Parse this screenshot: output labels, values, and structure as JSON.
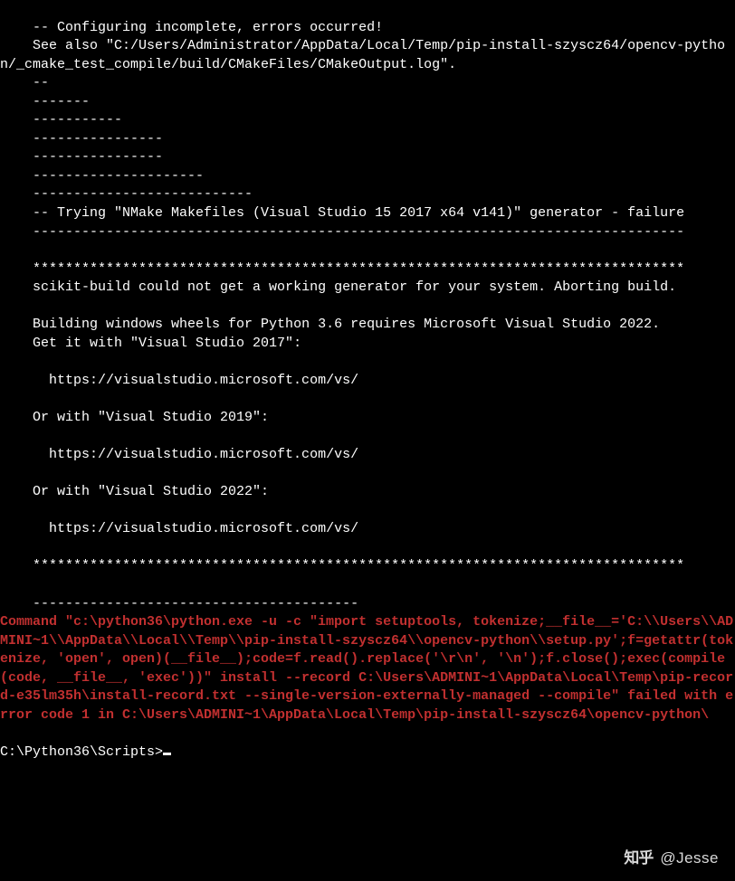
{
  "terminal": {
    "lines_white": [
      "    -- Configuring incomplete, errors occurred!",
      "    See also \"C:/Users/Administrator/AppData/Local/Temp/pip-install-szyscz64/opencv-python/_cmake_test_compile/build/CMakeFiles/CMakeOutput.log\".",
      "    --",
      "    -------",
      "    -----------",
      "    ----------------",
      "    ----------------",
      "    ---------------------",
      "    ---------------------------",
      "    -- Trying \"NMake Makefiles (Visual Studio 15 2017 x64 v141)\" generator - failure",
      "    --------------------------------------------------------------------------------",
      "",
      "    ********************************************************************************",
      "    scikit-build could not get a working generator for your system. Aborting build.",
      "",
      "    Building windows wheels for Python 3.6 requires Microsoft Visual Studio 2022.",
      "    Get it with \"Visual Studio 2017\":",
      "",
      "      https://visualstudio.microsoft.com/vs/",
      "",
      "    Or with \"Visual Studio 2019\":",
      "",
      "      https://visualstudio.microsoft.com/vs/",
      "",
      "    Or with \"Visual Studio 2022\":",
      "",
      "      https://visualstudio.microsoft.com/vs/",
      "",
      "    ********************************************************************************",
      "",
      "    ----------------------------------------"
    ],
    "error_text": "Command \"c:\\python36\\python.exe -u -c \"import setuptools, tokenize;__file__='C:\\\\Users\\\\ADMINI~1\\\\AppData\\\\Local\\\\Temp\\\\pip-install-szyscz64\\\\opencv-python\\\\setup.py';f=getattr(tokenize, 'open', open)(__file__);code=f.read().replace('\\r\\n', '\\n');f.close();exec(compile(code, __file__, 'exec'))\" install --record C:\\Users\\ADMINI~1\\AppData\\Local\\Temp\\pip-record-e35lm35h\\install-record.txt --single-version-externally-managed --compile\" failed with error code 1 in C:\\Users\\ADMINI~1\\AppData\\Local\\Temp\\pip-install-szyscz64\\opencv-python\\",
    "prompt": "C:\\Python36\\Scripts>"
  },
  "watermark": {
    "logo": "知乎",
    "handle": "@Jesse"
  }
}
